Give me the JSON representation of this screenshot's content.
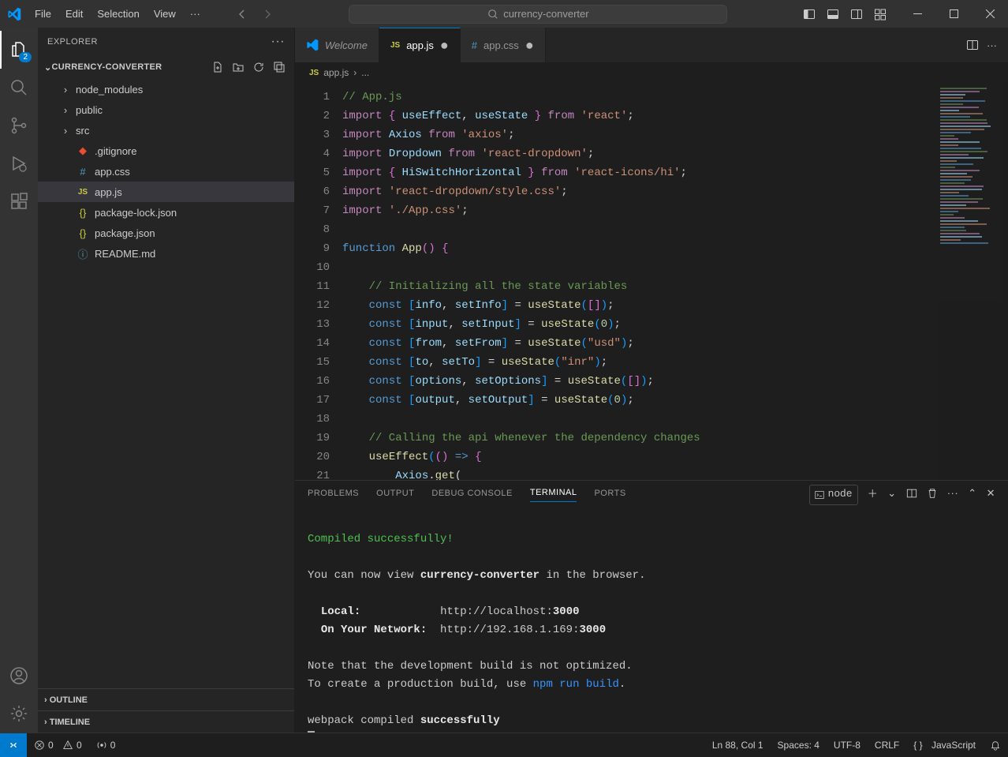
{
  "title_menu": [
    "File",
    "Edit",
    "Selection",
    "View"
  ],
  "search_placeholder": "currency-converter",
  "activity_badge": "2",
  "sidebar": {
    "title": "EXPLORER",
    "project": "CURRENCY-CONVERTER",
    "tree": {
      "node_modules": "node_modules",
      "public": "public",
      "src": "src",
      "gitignore": ".gitignore",
      "app_css": "app.css",
      "app_js": "app.js",
      "pkg_lock": "package-lock.json",
      "pkg": "package.json",
      "readme": "README.md"
    },
    "outline": "OUTLINE",
    "timeline": "TIMELINE"
  },
  "tabs": {
    "welcome": "Welcome",
    "appjs": "app.js",
    "appcss": "app.css"
  },
  "breadcrumb": {
    "file": "app.js",
    "sep": "›",
    "more": "..."
  },
  "code_lines": [
    {
      "n": 1,
      "t": "comment",
      "text": "// App.js"
    },
    {
      "n": 2,
      "t": "import1"
    },
    {
      "n": 3,
      "t": "import2"
    },
    {
      "n": 4,
      "t": "import3"
    },
    {
      "n": 5,
      "t": "import4"
    },
    {
      "n": 6,
      "t": "import5"
    },
    {
      "n": 7,
      "t": "import6"
    },
    {
      "n": 8,
      "t": "blank"
    },
    {
      "n": 9,
      "t": "func"
    },
    {
      "n": 10,
      "t": "blank"
    },
    {
      "n": 11,
      "t": "comment2",
      "text": "    // Initializing all the state variables"
    },
    {
      "n": 12,
      "t": "state1"
    },
    {
      "n": 13,
      "t": "state2"
    },
    {
      "n": 14,
      "t": "state3"
    },
    {
      "n": 15,
      "t": "state4"
    },
    {
      "n": 16,
      "t": "state5"
    },
    {
      "n": 17,
      "t": "state6"
    },
    {
      "n": 18,
      "t": "blank"
    },
    {
      "n": 19,
      "t": "comment3",
      "text": "    // Calling the api whenever the dependency changes"
    },
    {
      "n": 20,
      "t": "effect"
    },
    {
      "n": 21,
      "t": "axios"
    }
  ],
  "panel_tabs": {
    "problems": "PROBLEMS",
    "output": "OUTPUT",
    "debug": "DEBUG CONSOLE",
    "terminal": "TERMINAL",
    "ports": "PORTS"
  },
  "terminal_label": "node",
  "terminal": {
    "l1": "Compiled successfully!",
    "l2a": "You can now view ",
    "l2b": "currency-converter",
    "l2c": " in the browser.",
    "l3a": "Local:",
    "l3b": "http://localhost:",
    "l3c": "3000",
    "l4a": "On Your Network:",
    "l4b": "http://192.168.1.169:",
    "l4c": "3000",
    "l5": "Note that the development build is not optimized.",
    "l6a": "To create a production build, use ",
    "l6b": "npm run build",
    "l6c": ".",
    "l7a": "webpack compiled ",
    "l7b": "successfully"
  },
  "status": {
    "errors": "0",
    "warnings": "0",
    "ports": "0",
    "ln": "Ln 88, Col 1",
    "spaces": "Spaces: 4",
    "enc": "UTF-8",
    "eol": "CRLF",
    "lang": "JavaScript"
  }
}
